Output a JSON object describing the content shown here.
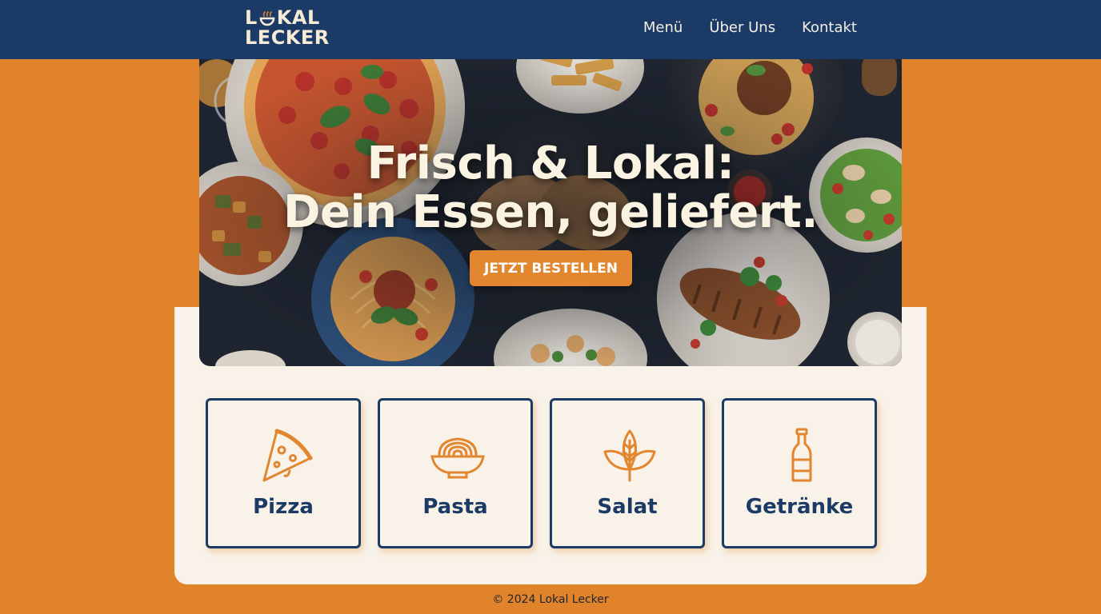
{
  "brand": {
    "logo_line1_a": "L",
    "logo_line1_b": "KAL",
    "logo_line2": "LECKER",
    "navy": "#1B3B66",
    "orange": "#E0832A",
    "cream": "#F8F2E8"
  },
  "nav": {
    "items": [
      {
        "label": "Menü"
      },
      {
        "label": "Über Uns"
      },
      {
        "label": "Kontakt"
      }
    ]
  },
  "hero": {
    "title_line1": "Frisch & Lokal:",
    "title_line2": "Dein Essen, geliefert.",
    "cta_label": "JETZT BESTELLEN"
  },
  "categories": [
    {
      "label": "Pizza",
      "icon": "pizza-slice-icon"
    },
    {
      "label": "Pasta",
      "icon": "pasta-bowl-icon"
    },
    {
      "label": "Salat",
      "icon": "leaf-icon"
    },
    {
      "label": "Getränke",
      "icon": "bottle-icon"
    }
  ],
  "footer": {
    "text": "© 2024 Lokal Lecker"
  }
}
